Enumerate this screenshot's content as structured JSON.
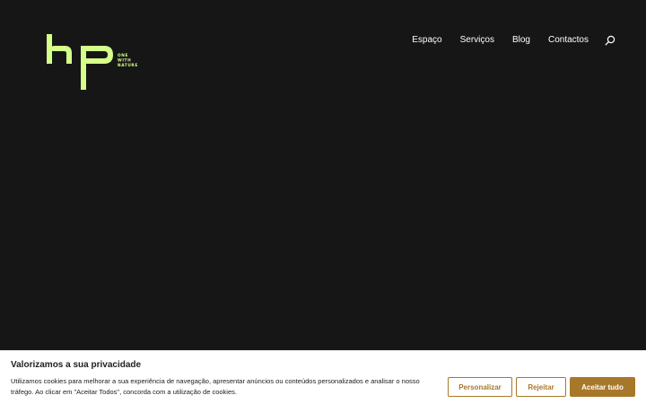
{
  "brand": {
    "logo_text": "hp",
    "tagline_lines": [
      "ONE",
      "WITH",
      "NATURE"
    ],
    "logo_color": "#d4ff8a"
  },
  "nav": {
    "items": [
      {
        "label": "Espaço"
      },
      {
        "label": "Serviços"
      },
      {
        "label": "Blog"
      },
      {
        "label": "Contactos"
      }
    ],
    "search_icon": "search-icon"
  },
  "cookie": {
    "title": "Valorizamos a sua privacidade",
    "text": "Utilizamos cookies para melhorar a sua experiência de navegação, apresentar anúncios ou conteúdos personalizados e analisar o nosso tráfego. Ao clicar em \"Aceitar Todos\", concorda com a utilização de cookies.",
    "customize_label": "Personalizar",
    "reject_label": "Rejeitar",
    "accept_label": "Aceitar tudo",
    "accent_color": "#a8782a"
  },
  "colors": {
    "background": "#161616",
    "nav_text": "#ffffff"
  }
}
